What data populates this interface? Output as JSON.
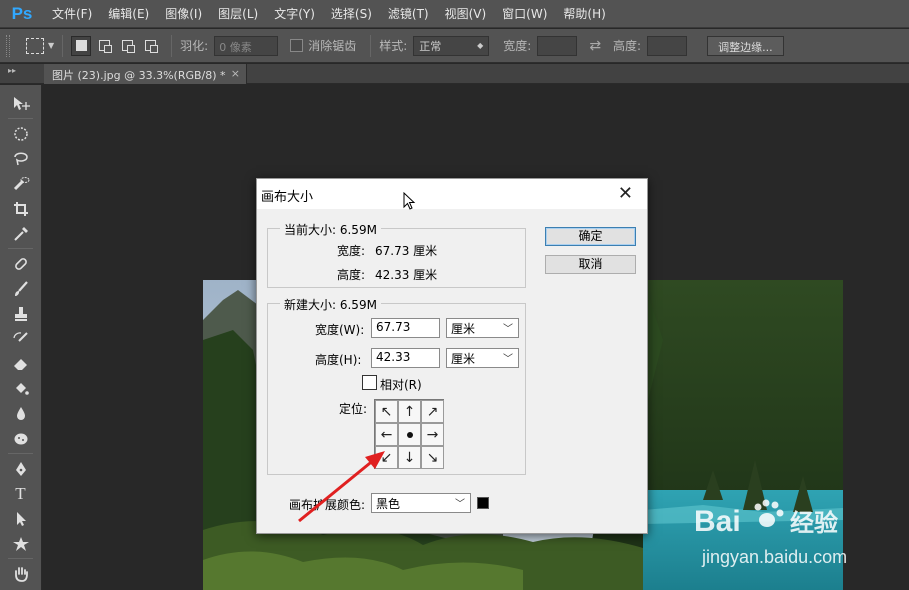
{
  "app": {
    "logo": "Ps",
    "accent": "#31a8ff"
  },
  "menu": [
    "文件(F)",
    "编辑(E)",
    "图像(I)",
    "图层(L)",
    "文字(Y)",
    "选择(S)",
    "滤镜(T)",
    "视图(V)",
    "窗口(W)",
    "帮助(H)"
  ],
  "options": {
    "feather_label": "羽化:",
    "feather_value": "0 像素",
    "antialias_label": "消除锯齿",
    "style_label": "样式:",
    "style_value": "正常",
    "width_label": "宽度:",
    "height_label": "高度:",
    "refine_button": "调整边缘..."
  },
  "document_tab": {
    "title": "图片 (23).jpg @ 33.3%(RGB/8) *",
    "close": "×"
  },
  "tools": [
    "move-tool",
    "ellipse-marquee-tool",
    "lasso-tool",
    "quick-selection-tool",
    "crop-tool",
    "eyedropper-tool",
    "healing-brush-tool",
    "brush-tool",
    "clone-stamp-tool",
    "history-brush-tool",
    "eraser-tool",
    "paint-bucket-tool",
    "blur-tool",
    "dodge-tool",
    "pen-tool",
    "type-tool",
    "path-selection-tool",
    "custom-shape-tool",
    "hand-tool"
  ],
  "dialog": {
    "title": "画布大小",
    "current": {
      "legend": "当前大小: 6.59M",
      "width_label": "宽度:",
      "width_value": "67.73 厘米",
      "height_label": "高度:",
      "height_value": "42.33 厘米"
    },
    "new": {
      "legend": "新建大小: 6.59M",
      "width_label": "宽度(W):",
      "width_value": "67.73",
      "width_unit": "厘米",
      "height_label": "高度(H):",
      "height_value": "42.33",
      "height_unit": "厘米",
      "relative_label": "相对(R)",
      "anchor_label": "定位:"
    },
    "extension_label": "画布扩展颜色:",
    "extension_value": "黑色",
    "ok": "确定",
    "cancel": "取消"
  },
  "watermark": {
    "brand": "Bai",
    "brand2": "经验",
    "url": "jingyan.baidu.com"
  }
}
